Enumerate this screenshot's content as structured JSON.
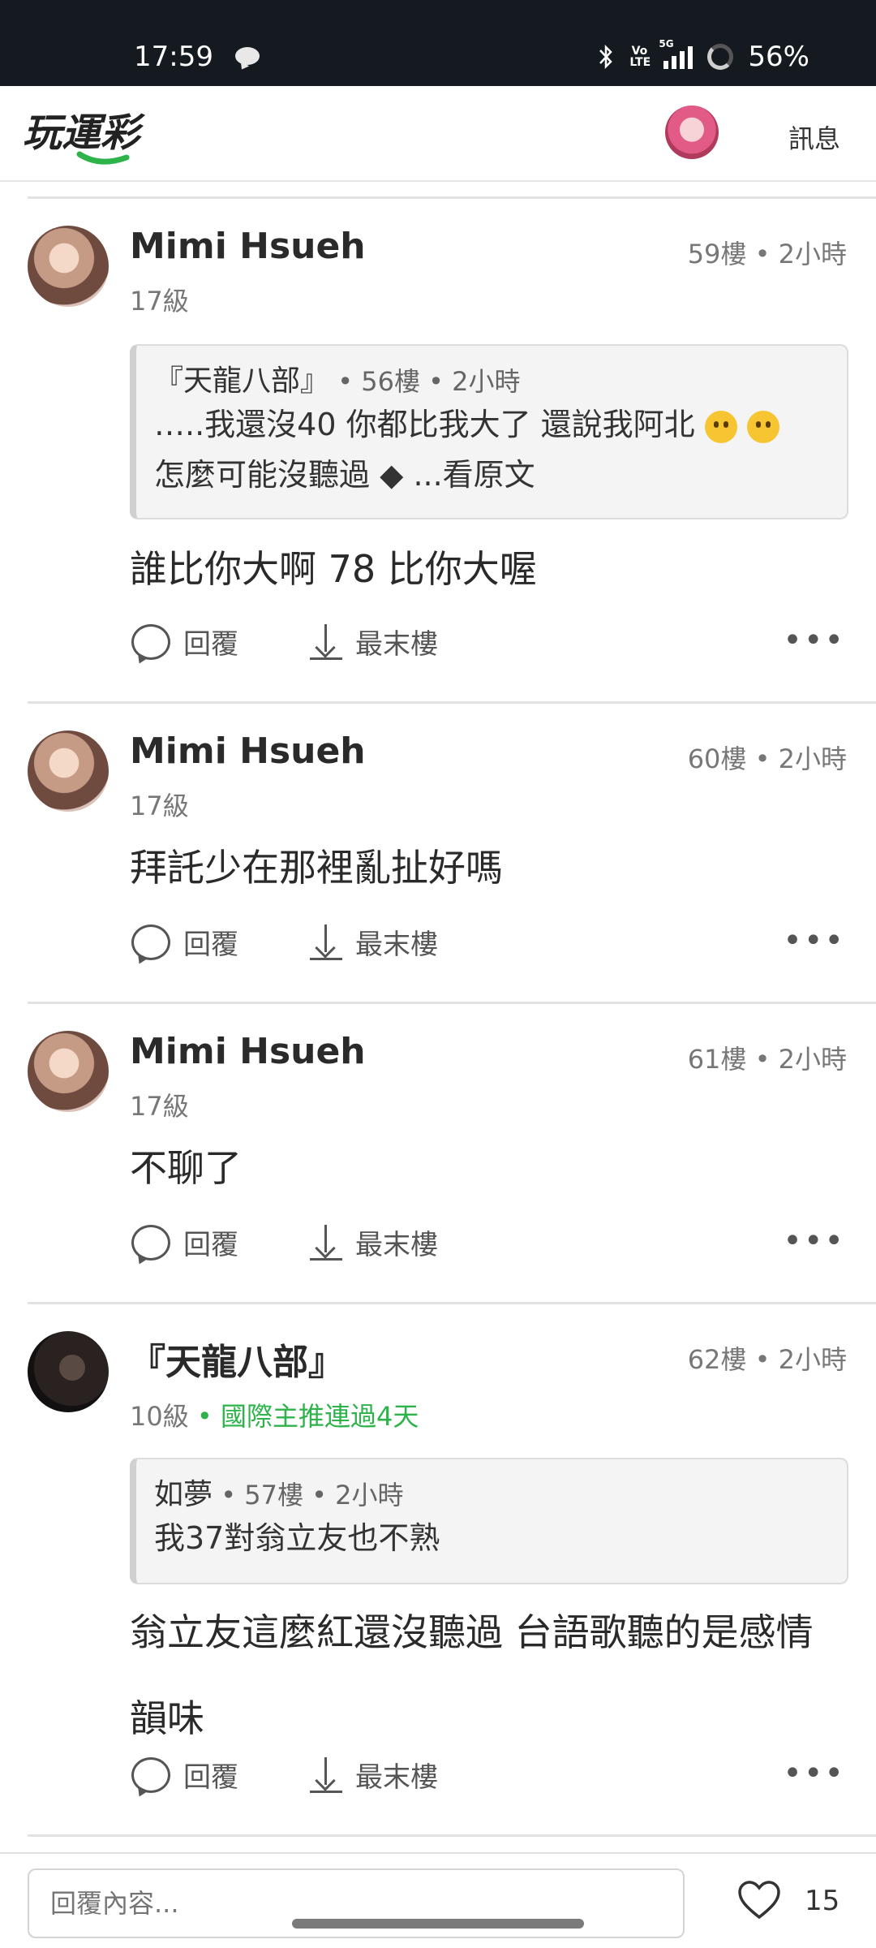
{
  "status_bar": {
    "time": "17:59",
    "network": "5G",
    "volte": "Vo LTE",
    "battery": "56%",
    "icons": [
      "chat-icon",
      "bluetooth-icon",
      "volte-icon",
      "signal-icon",
      "battery-icon"
    ]
  },
  "header": {
    "logo_text": "玩運彩",
    "messages_label": "訊息",
    "accent_color": "#2db34a"
  },
  "posts": [
    {
      "username": "Mimi Hsueh",
      "floor": "59樓 • 2小時",
      "level": "17級",
      "quote": {
        "author": "『天龍八部』",
        "meta": "• 56樓 • 2小時",
        "line1": "…..我還沒40 你都比我大了 還說我阿北",
        "line2": "怎麼可能沒聽過",
        "more": "...看原文",
        "emoji": "melting-face"
      },
      "text": "誰比你大啊 78 比你大喔",
      "reply_label": "回覆",
      "last_label": "最末樓"
    },
    {
      "username": "Mimi Hsueh",
      "floor": "60樓 • 2小時",
      "level": "17級",
      "text": "拜託少在那裡亂扯好嗎",
      "reply_label": "回覆",
      "last_label": "最末樓"
    },
    {
      "username": "Mimi Hsueh",
      "floor": "61樓 • 2小時",
      "level": "17級",
      "text": "不聊了",
      "reply_label": "回覆",
      "last_label": "最末樓"
    },
    {
      "username": "『天龍八部』",
      "floor": "62樓 • 2小時",
      "level": "10級",
      "badge": "• 國際主推連過4天",
      "quote": {
        "author": "如夢",
        "meta": "• 57樓 • 2小時",
        "line1": "我37對翁立友也不熟"
      },
      "text": "翁立友這麼紅還沒聽過 台語歌聽的是感情韻味",
      "reply_label": "回覆",
      "last_label": "最末樓"
    }
  ],
  "reply_bar": {
    "placeholder": "回覆內容...",
    "like_count": "15"
  }
}
